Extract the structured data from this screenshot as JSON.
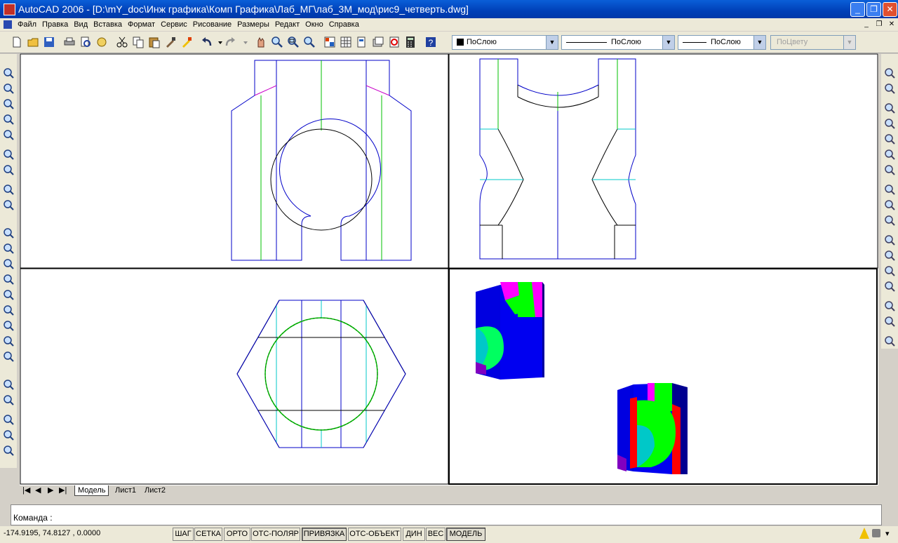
{
  "window": {
    "title": "AutoCAD 2006 - [D:\\mY_doc\\Инж графика\\Комп Графика\\Лаб_МГ\\лаб_3М_мод\\рис9_четверть.dwg]"
  },
  "menu": [
    "Файл",
    "Правка",
    "Вид",
    "Вставка",
    "Формат",
    "Сервис",
    "Рисование",
    "Размеры",
    "Редакт",
    "Окно",
    "Справка"
  ],
  "toolbar": {
    "layer_color": "ПоСлою",
    "linetype": "ПоСлою",
    "lineweight": "ПоСлою",
    "plotstyle": "ПоЦвету"
  },
  "tabs": [
    "Модель",
    "Лист1",
    "Лист2"
  ],
  "command": {
    "prompt": "Команда :"
  },
  "status": {
    "coords": "-174.9195, 74.8127 , 0.0000",
    "buttons": [
      {
        "label": "ШАГ",
        "on": false
      },
      {
        "label": "СЕТКА",
        "on": false
      },
      {
        "label": "ОРТО",
        "on": false
      },
      {
        "label": "ОТС-ПОЛЯР",
        "on": false
      },
      {
        "label": "ПРИВЯЗКА",
        "on": true
      },
      {
        "label": "ОТС-ОБЪЕКТ",
        "on": false
      },
      {
        "label": "ДИН",
        "on": false
      },
      {
        "label": "ВЕС",
        "on": false
      },
      {
        "label": "МОДЕЛЬ",
        "on": true
      }
    ]
  },
  "colors": {
    "outline": "#0000c8",
    "axis": "#00c000",
    "cut": "#00c8c8",
    "hatch": "#c800c8",
    "solid_blue": "#0000e0",
    "solid_green": "#00ff00",
    "solid_magenta": "#ff00ff",
    "solid_red": "#ff0000",
    "solid_cyan": "#00ffff"
  }
}
